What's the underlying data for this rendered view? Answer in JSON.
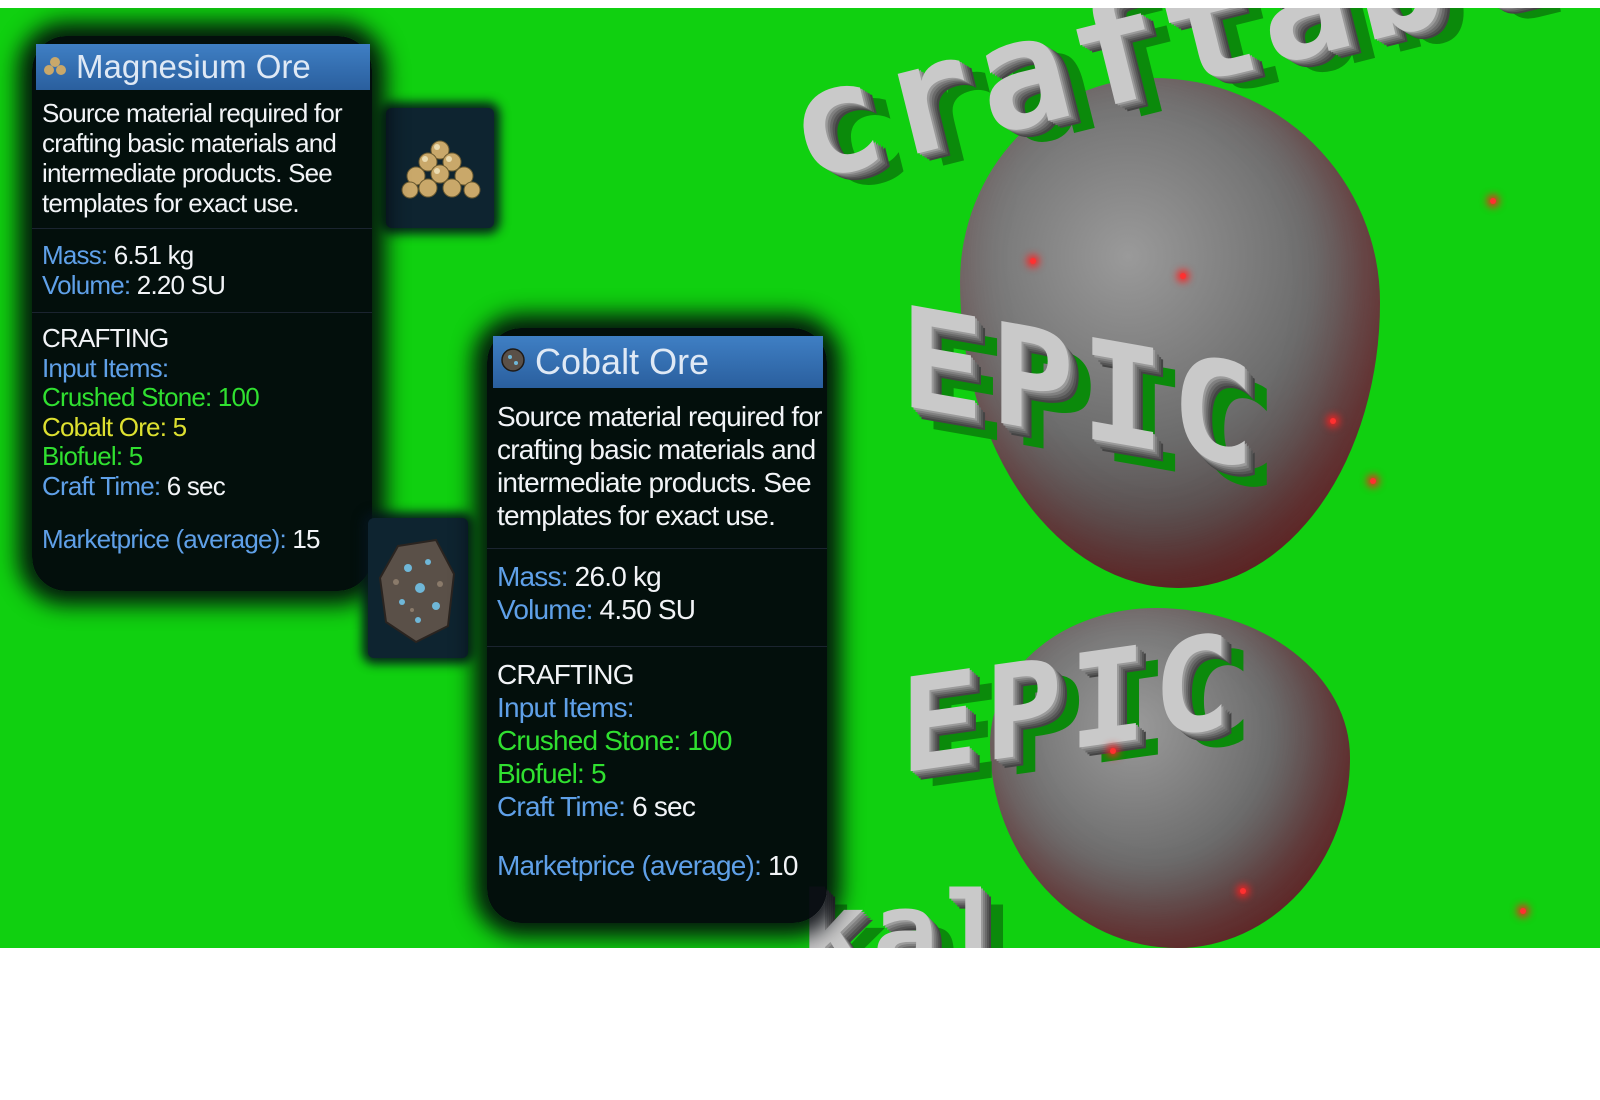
{
  "magnesium": {
    "title": "Magnesium Ore",
    "icon": "magnesium-ore-icon",
    "description": [
      "Source material required for",
      "crafting basic materials and",
      "intermediate products. See",
      "templates for exact use."
    ],
    "mass_label": "Mass:",
    "mass_value": " 6.51 kg",
    "volume_label": "Volume:",
    "volume_value": " 2.20 SU",
    "crafting_header": "CRAFTING",
    "input_items_label": "Input Items:",
    "inputs": [
      "Crushed Stone: 100",
      "Cobalt Ore: 5",
      "Biofuel: 5"
    ],
    "craft_time_label": "Craft Time:",
    "craft_time_value": " 6 sec",
    "price_label": "Marketprice (average):",
    "price_value": " 15"
  },
  "cobalt": {
    "title": "Cobalt Ore",
    "icon": "cobalt-ore-icon",
    "description": [
      "Source material required for",
      "crafting basic materials and",
      "intermediate products. See",
      "templates for exact use."
    ],
    "mass_label": "Mass:",
    "mass_value": " 26.0 kg",
    "volume_label": "Volume:",
    "volume_value": " 4.50 SU",
    "crafting_header": "CRAFTING",
    "input_items_label": "Input Items:",
    "inputs": [
      "Crushed Stone: 100",
      "Biofuel: 5"
    ],
    "craft_time_label": "Craft Time:",
    "craft_time_value": " 6 sec",
    "price_label": "Marketprice (average):",
    "price_value": " 10"
  },
  "block_text": {
    "word_1": "craftable",
    "word_2": "EPIC",
    "word_3": "EPIC",
    "word_4": "kal"
  },
  "colors": {
    "background": "#10d010",
    "title_bar": "#3a73b5",
    "key_text": "#5fa0e8",
    "input_green": "#30e030",
    "input_yellow": "#dde030"
  }
}
